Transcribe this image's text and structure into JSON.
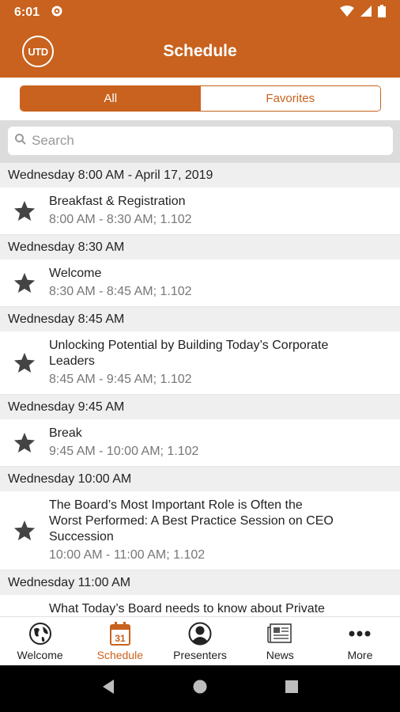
{
  "status_bar": {
    "time": "6:01"
  },
  "app_bar": {
    "logo_text": "UTD",
    "title": "Schedule"
  },
  "segments": {
    "all": "All",
    "favorites": "Favorites"
  },
  "search": {
    "placeholder": "Search"
  },
  "schedule": [
    {
      "header": "Wednesday 8:00 AM - April 17, 2019",
      "items": [
        {
          "title_lines": [
            "Breakfast & Registration"
          ],
          "subtitle": "8:00 AM - 8:30 AM; 1.102"
        }
      ]
    },
    {
      "header": "Wednesday 8:30 AM",
      "items": [
        {
          "title_lines": [
            "Welcome"
          ],
          "subtitle": "8:30 AM - 8:45 AM; 1.102"
        }
      ]
    },
    {
      "header": "Wednesday 8:45 AM",
      "items": [
        {
          "title_lines": [
            "Unlocking Potential by Building Today’s Corporate",
            "Leaders"
          ],
          "subtitle": "8:45 AM - 9:45 AM; 1.102"
        }
      ]
    },
    {
      "header": "Wednesday 9:45 AM",
      "items": [
        {
          "title_lines": [
            "Break"
          ],
          "subtitle": "9:45 AM - 10:00 AM; 1.102"
        }
      ]
    },
    {
      "header": "Wednesday 10:00 AM",
      "items": [
        {
          "title_lines": [
            "The Board’s Most Important Role is Often the",
            "Worst Performed: A Best Practice Session on CEO",
            "Succession"
          ],
          "subtitle": "10:00 AM - 11:00 AM; 1.102"
        }
      ]
    },
    {
      "header": "Wednesday 11:00 AM",
      "items": [
        {
          "title_lines": [
            "What Today’s Board needs to know about Private"
          ],
          "subtitle": ""
        }
      ]
    }
  ],
  "bottom_nav": [
    {
      "label": "Welcome",
      "icon": "globe-icon",
      "active": false
    },
    {
      "label": "Schedule",
      "icon": "calendar-icon",
      "active": true,
      "icon_text": "31"
    },
    {
      "label": "Presenters",
      "icon": "person-icon",
      "active": false
    },
    {
      "label": "News",
      "icon": "newspaper-icon",
      "active": false
    },
    {
      "label": "More",
      "icon": "more-dots-icon",
      "active": false
    }
  ],
  "colors": {
    "accent": "#c8621e",
    "section_bg": "#efefef",
    "search_bg": "#dcdcdc"
  }
}
